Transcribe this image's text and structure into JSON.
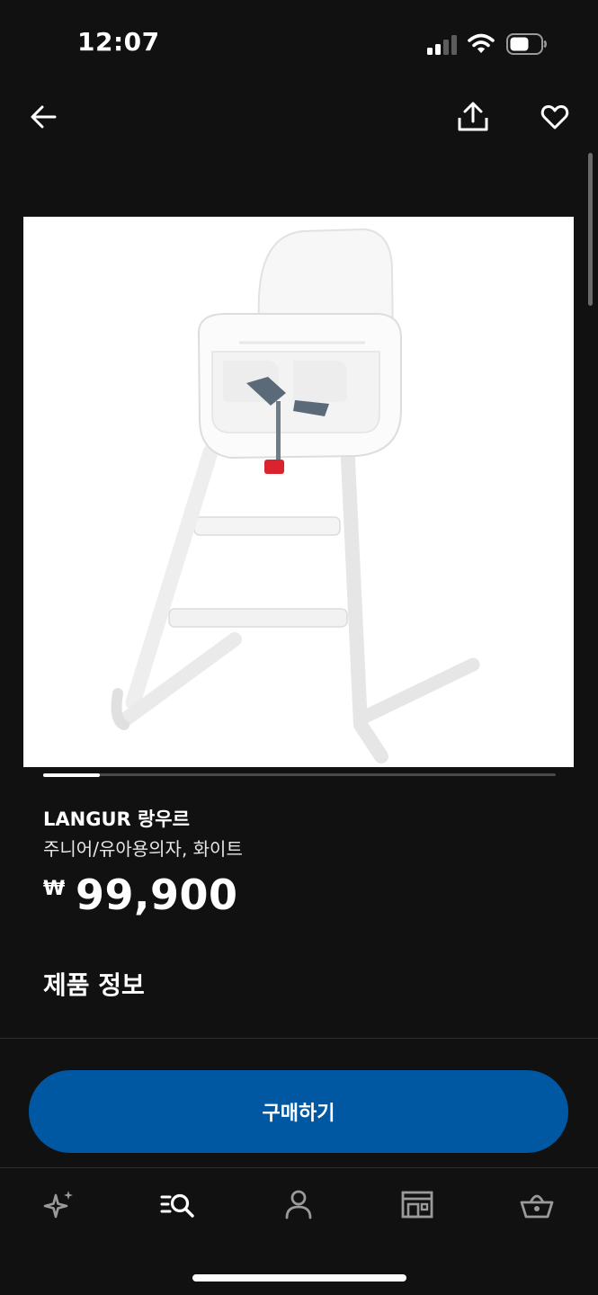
{
  "status_bar": {
    "time": "12:07",
    "icons": [
      "cellular-signal-icon",
      "wifi-icon",
      "battery-icon"
    ]
  },
  "top_nav": {
    "back_icon": "arrow-left-icon",
    "share_icon": "share-icon",
    "favorite_icon": "heart-icon"
  },
  "product": {
    "image_alt": "white-high-chair-image",
    "carousel_progress": 0.11,
    "name": "LANGUR 랑우르",
    "description": "주니어/유아용의자, 화이트",
    "price_currency": "₩",
    "price": "99,900"
  },
  "sections": {
    "product_info_title": "제품 정보"
  },
  "actions": {
    "buy_label": "구매하기"
  },
  "tab_bar": {
    "items": [
      {
        "icon": "sparkle-icon",
        "active": false
      },
      {
        "icon": "search-list-icon",
        "active": true
      },
      {
        "icon": "profile-icon",
        "active": false
      },
      {
        "icon": "store-icon",
        "active": false
      },
      {
        "icon": "basket-icon",
        "active": false
      }
    ]
  },
  "colors": {
    "background": "#111111",
    "accent_blue": "#0058a3",
    "text_primary": "#ffffff",
    "inactive_icon": "#9a9a9a"
  }
}
